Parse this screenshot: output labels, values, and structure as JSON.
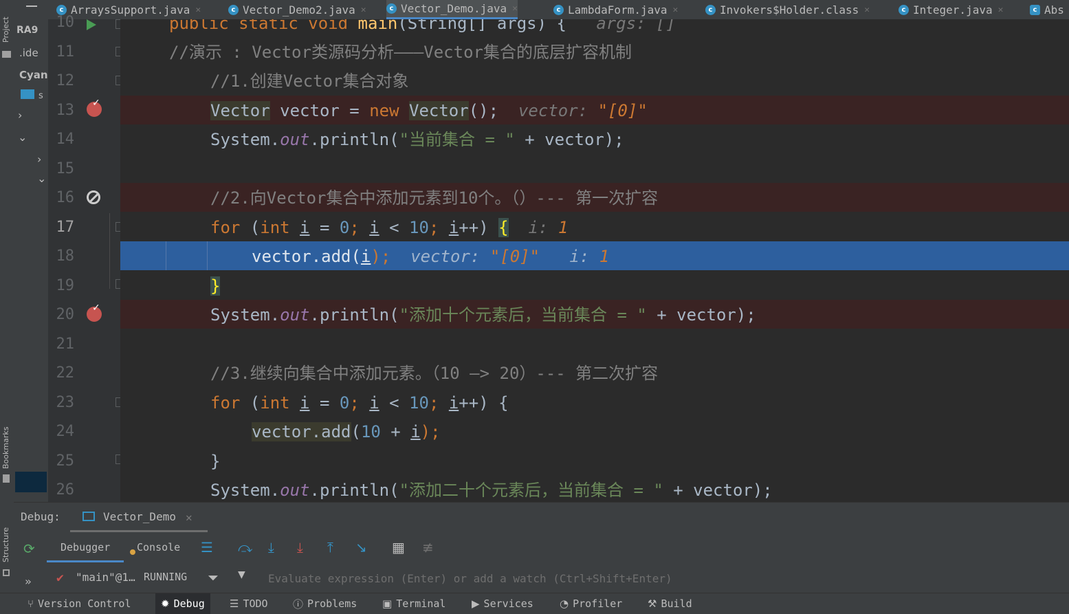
{
  "left_strip": {
    "project_label": "Project",
    "bookmarks_label": "Bookmarks",
    "structure_label": "Structure"
  },
  "project_panel": {
    "item1": "RA9",
    "item2": ".ide",
    "item3": "Cyan",
    "item4": "s"
  },
  "tabs": [
    {
      "label": "ArraysSupport.java"
    },
    {
      "label": "Vector_Demo2.java"
    },
    {
      "label": "Vector_Demo.java"
    },
    {
      "label": "LambdaForm.java"
    },
    {
      "label": "Invokers$Holder.class"
    },
    {
      "label": "Integer.java"
    },
    {
      "label": "Abs"
    }
  ],
  "line_numbers": [
    "10",
    "11",
    "12",
    "13",
    "14",
    "15",
    "16",
    "17",
    "18",
    "19",
    "20",
    "21",
    "22",
    "23",
    "24",
    "25",
    "26"
  ],
  "code": {
    "l10_a": "public static void ",
    "l10_b": "main",
    "l10_c": "(String[] args) {",
    "l10_hint": "args: []",
    "l11": "//演示 : Vector类源码分析———Vector集合的底层扩容机制",
    "l12": "//1.创建Vector集合对象",
    "l13_type": "Vector",
    "l13_a": " vector = ",
    "l13_new": "new ",
    "l13_ctor": "Vector",
    "l13_b": "();",
    "l13_hint_k": "vector: ",
    "l13_hint_v": "\"[0]\"",
    "l14_a": "System.",
    "l14_out": "out",
    "l14_b": ".println(",
    "l14_str": "\"当前集合 = \"",
    "l14_c": " + vector);",
    "l16": "//2.向Vector集合中添加元素到10个。（）--- 第一次扩容",
    "l17_for": "for ",
    "l17_a": "(",
    "l17_int": "int ",
    "l17_i1": "i",
    "l17_b": " = ",
    "l17_n0": "0",
    "l17_c": "; ",
    "l17_i2": "i",
    "l17_d": " < ",
    "l17_n10": "10",
    "l17_e": "; ",
    "l17_i3": "i",
    "l17_f": "++) ",
    "l17_brace": "{",
    "l17_hint_k": "i: ",
    "l17_hint_v": "1",
    "l18_a": "vector.add(",
    "l18_i": "i",
    "l18_b": ");",
    "l18_hint_k": "vector: ",
    "l18_hint_v": "\"[0]\"",
    "l18_hint2_k": "i: ",
    "l18_hint2_v": "1",
    "l19_brace": "}",
    "l20_a": "System.",
    "l20_out": "out",
    "l20_b": ".println(",
    "l20_str": "\"添加十个元素后，当前集合 = \"",
    "l20_c": " + vector);",
    "l22": "//3.继续向集合中添加元素。（10 —> 20）--- 第二次扩容",
    "l23_for": "for ",
    "l23_a": "(",
    "l23_int": "int ",
    "l23_i1": "i",
    "l23_b": " = ",
    "l23_n0": "0",
    "l23_c": "; ",
    "l23_i2": "i",
    "l23_d": " < ",
    "l23_n10": "10",
    "l23_e": "; ",
    "l23_i3": "i",
    "l23_f": "++) {",
    "l24_a": "vector.add",
    "l24_b": "(",
    "l24_n": "10",
    "l24_c": " + ",
    "l24_i": "i",
    "l24_d": ");",
    "l25": "}",
    "l26_a": "System.",
    "l26_out": "out",
    "l26_b": ".println(",
    "l26_str": "\"添加二十个元素后，当前集合 = \"",
    "l26_c": " + vector);"
  },
  "debug": {
    "label": "Debug:",
    "session": "Vector_Demo",
    "tab_debugger": "Debugger",
    "tab_console": "Console",
    "thread": "\"main\"@1…",
    "thread_state": "RUNNING",
    "expr_placeholder": "Evaluate expression (Enter) or add a watch (Ctrl+Shift+Enter)"
  },
  "bottom_bar": {
    "version_control": "Version Control",
    "debug": "Debug",
    "todo": "TODO",
    "problems": "Problems",
    "terminal": "Terminal",
    "services": "Services",
    "profiler": "Profiler",
    "build": "Build"
  },
  "colors": {
    "keyword": "#cc7832",
    "number": "#6897bb",
    "string": "#6a8759",
    "comment": "#808080",
    "execution_line": "#2d5f9e",
    "breakpoint_line": "#3a2323"
  }
}
